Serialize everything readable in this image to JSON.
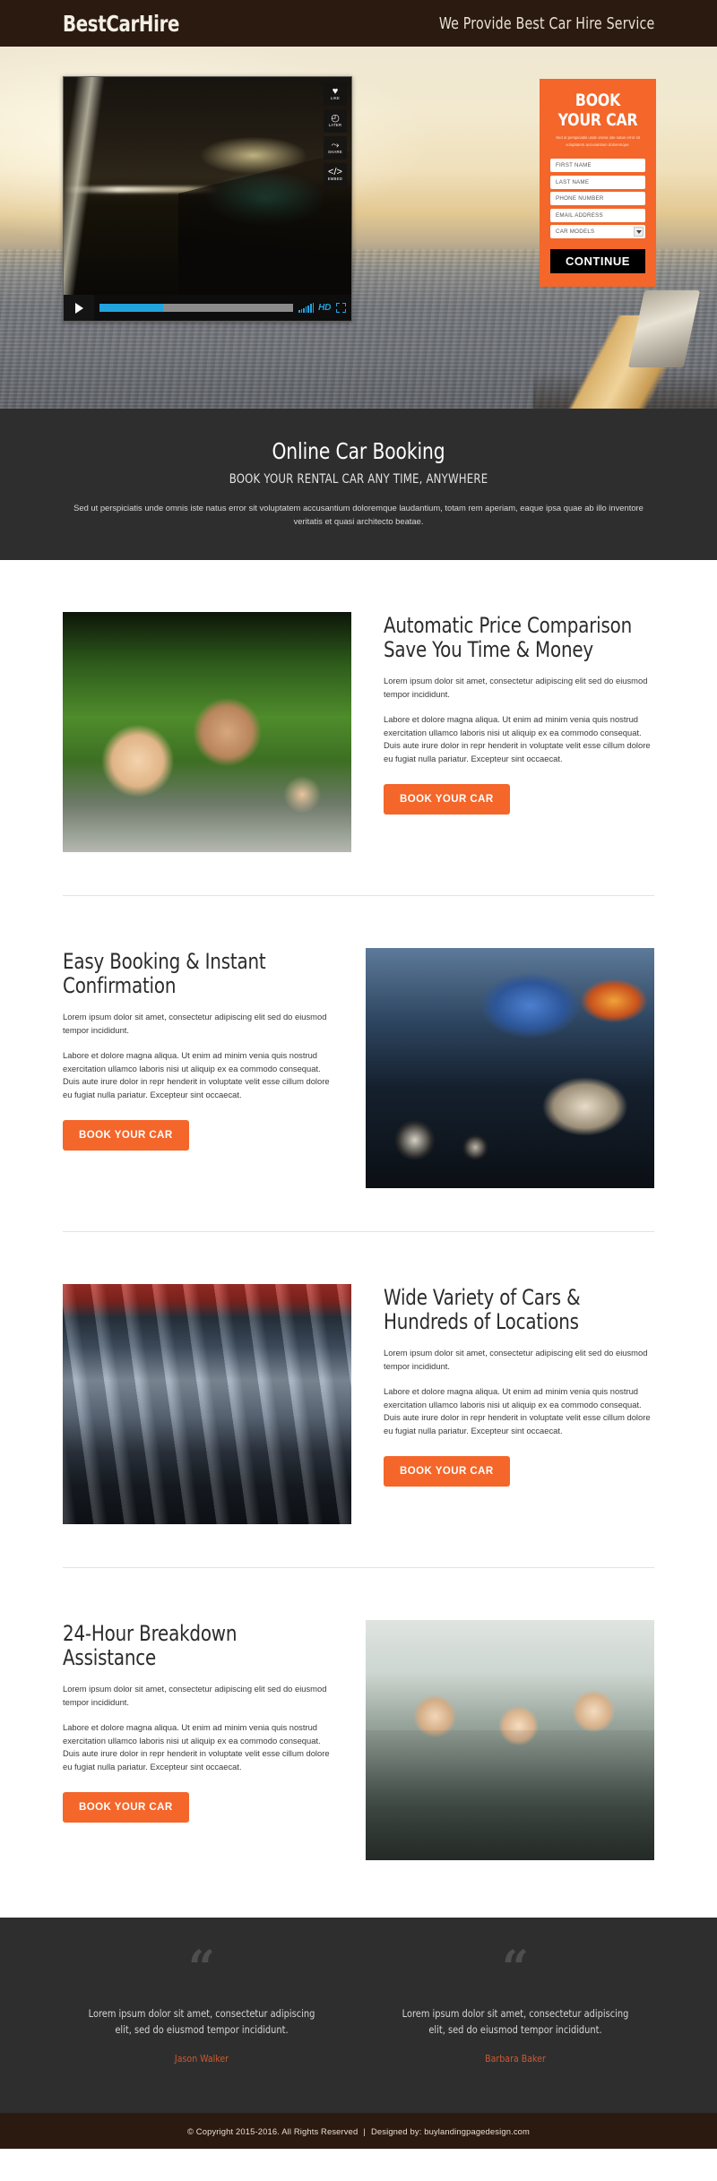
{
  "header": {
    "brand": "BestCarHire",
    "tagline": "We Provide Best Car Hire Service"
  },
  "hero": {
    "player": {
      "actions": [
        {
          "glyph": "♥",
          "label": "LIKE",
          "icon": "heart-icon"
        },
        {
          "glyph": "◴",
          "label": "LATER",
          "icon": "clock-icon"
        },
        {
          "glyph": "⤳",
          "label": "SHARE",
          "icon": "share-icon"
        },
        {
          "glyph": "</>",
          "label": "EMBED",
          "icon": "embed-icon"
        }
      ],
      "hd_label": "HD",
      "progress_percent": 33
    },
    "form": {
      "title": "BOOK YOUR CAR",
      "subtitle": "Sed ut perspiciatis unde omnis iste natus error sit voluptatem accusantium doloremque.",
      "fields": [
        {
          "name": "first-name",
          "placeholder": "FIRST NAME",
          "value": ""
        },
        {
          "name": "last-name",
          "placeholder": "LAST NAME",
          "value": ""
        },
        {
          "name": "phone-number",
          "placeholder": "PHONE NUMBER",
          "value": ""
        },
        {
          "name": "email-address",
          "placeholder": "EMAIL ADDRESS",
          "value": ""
        }
      ],
      "select": {
        "name": "car-models",
        "value": "CAR MODELS"
      },
      "submit_label": "CONTINUE"
    }
  },
  "intro": {
    "heading": "Online Car Booking",
    "subheading": "BOOK YOUR RENTAL CAR ANY TIME, ANYWHERE",
    "paragraph": "Sed ut perspiciatis unde omnis iste natus error sit voluptatem accusantium doloremque laudantium, totam rem aperiam, eaque ipsa quae ab illo inventore veritatis et quasi architecto beatae."
  },
  "features": [
    {
      "heading": "Automatic Price Comparison Save You Time & Money",
      "paragraph1": "Lorem ipsum dolor sit amet, consectetur adipiscing elit sed do eiusmod tempor incididunt.",
      "paragraph2": "Labore et dolore magna aliqua. Ut enim ad minim venia quis nostrud exercitation ullamco laboris nisi ut aliquip ex ea commodo consequat. Duis aute irure dolor in repr henderit in voluptate velit esse cillum dolore eu fugiat nulla pariatur. Excepteur sint occaecat.",
      "button_label": "BOOK YOUR CAR",
      "image_alt": "smiling-couple-in-car"
    },
    {
      "heading": "Easy Booking & Instant Confirmation",
      "paragraph1": "Lorem ipsum dolor sit amet, consectetur adipiscing elit sed do eiusmod tempor incididunt.",
      "paragraph2": "Labore et dolore magna aliqua. Ut enim ad minim venia quis nostrud exercitation ullamco laboris nisi ut aliquip ex ea commodo consequat. Duis aute irure dolor in repr henderit in voluptate velit esse cillum dolore eu fugiat nulla pariatur. Excepteur sint occaecat.",
      "button_label": "BOOK YOUR CAR",
      "image_alt": "driving-dashboard-speedometer"
    },
    {
      "heading": "Wide Variety of Cars & Hundreds of Locations",
      "paragraph1": "Lorem ipsum dolor sit amet, consectetur adipiscing elit sed do eiusmod tempor incididunt.",
      "paragraph2": "Labore et dolore magna aliqua. Ut enim ad minim venia quis nostrud exercitation ullamco laboris nisi ut aliquip ex ea commodo consequat. Duis aute irure dolor in repr henderit in voluptate velit esse cillum dolore eu fugiat nulla pariatur. Excepteur sint occaecat.",
      "button_label": "BOOK YOUR CAR",
      "image_alt": "row-of-parked-cars"
    },
    {
      "heading": "24-Hour Breakdown Assistance",
      "paragraph1": "Lorem ipsum dolor sit amet, consectetur adipiscing elit sed do eiusmod tempor incididunt.",
      "paragraph2": "Labore et dolore magna aliqua. Ut enim ad minim venia quis nostrud exercitation ullamco laboris nisi ut aliquip ex ea commodo consequat. Duis aute irure dolor in repr henderit in voluptate velit esse cillum dolore eu fugiat nulla pariatur. Excepteur sint occaecat.",
      "button_label": "BOOK YOUR CAR",
      "image_alt": "office-handshake-customers"
    }
  ],
  "testimonials": [
    {
      "quote_mark": "“",
      "text": "Lorem ipsum dolor sit amet, consectetur adipiscing elit, sed do eiusmod tempor incididunt.",
      "name": "Jason Walker"
    },
    {
      "quote_mark": "“",
      "text": "Lorem ipsum dolor sit amet, consectetur adipiscing elit, sed do eiusmod tempor incididunt.",
      "name": "Barbara Baker"
    }
  ],
  "footer": {
    "copyright": "© Copyright 2015-2016. All Rights Reserved",
    "separator": "|",
    "credit": "Designed by: buylandingpagedesign.com"
  },
  "colors": {
    "accent_orange": "#f4662a",
    "dark_brown": "#2b1a10",
    "dark_gray": "#2e2e2e",
    "testimonial_name": "#cc5a2e",
    "player_blue": "#22a3e0"
  }
}
